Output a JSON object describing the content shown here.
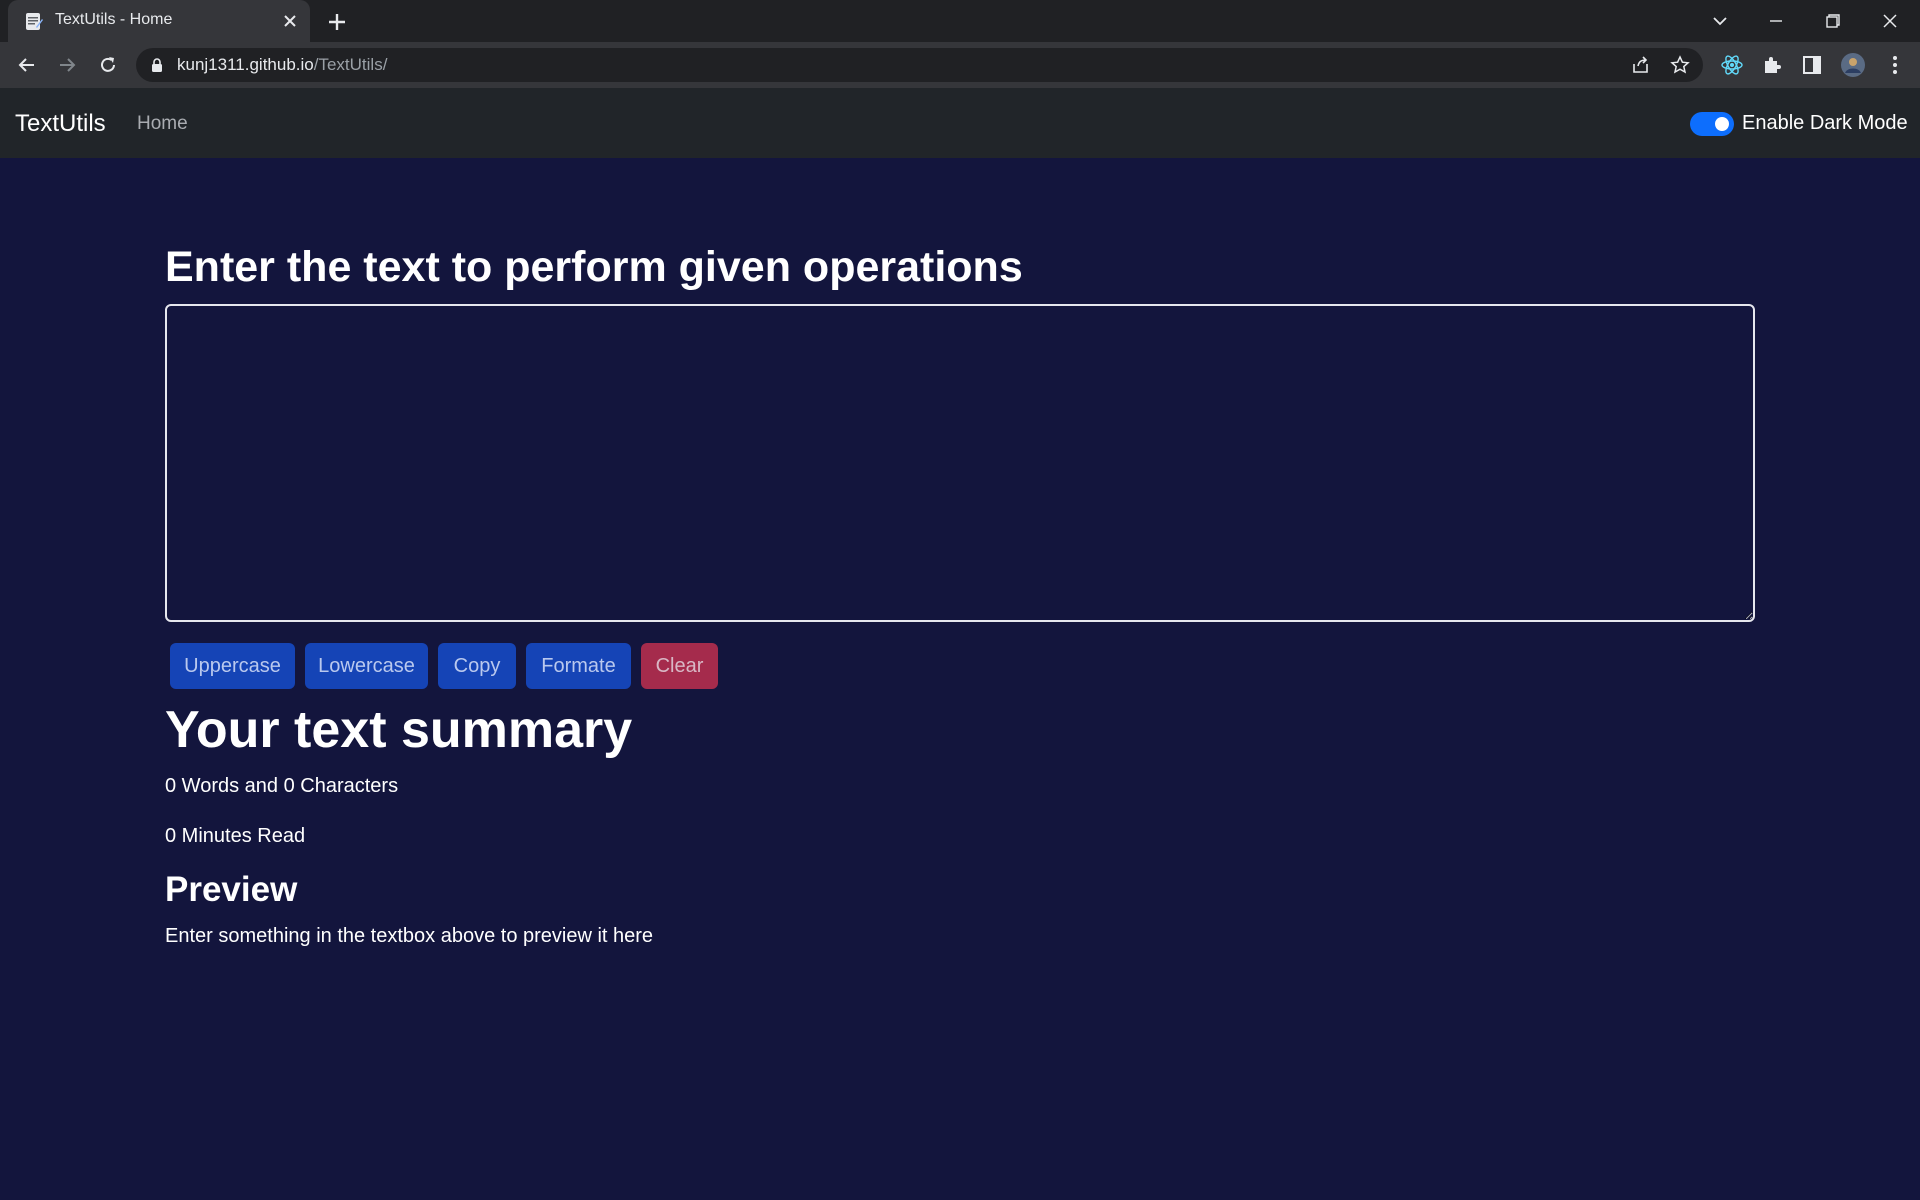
{
  "browser": {
    "tab_title": "TextUtils - Home",
    "url_host": "kunj1311.github.io",
    "url_path": "/TextUtils/"
  },
  "navbar": {
    "brand": "TextUtils",
    "home_link": "Home",
    "dark_mode_label": "Enable Dark Mode",
    "dark_mode_enabled": true
  },
  "main": {
    "heading": "Enter the text to perform given operations",
    "textarea_value": "",
    "buttons": {
      "uppercase": "Uppercase",
      "lowercase": "Lowercase",
      "copy": "Copy",
      "formate": "Formate",
      "clear": "Clear"
    },
    "summary_title": "Your text summary",
    "words_chars": "0 Words and 0 Characters",
    "minutes_read": "0 Minutes Read",
    "preview_title": "Preview",
    "preview_text": "Enter something in the textbox above to preview it here"
  },
  "colors": {
    "page_bg": "#13153d",
    "navbar_bg": "#212529",
    "primary_button": "#1544b6",
    "danger_button": "#a52b4c",
    "switch_on": "#0d6efd"
  }
}
